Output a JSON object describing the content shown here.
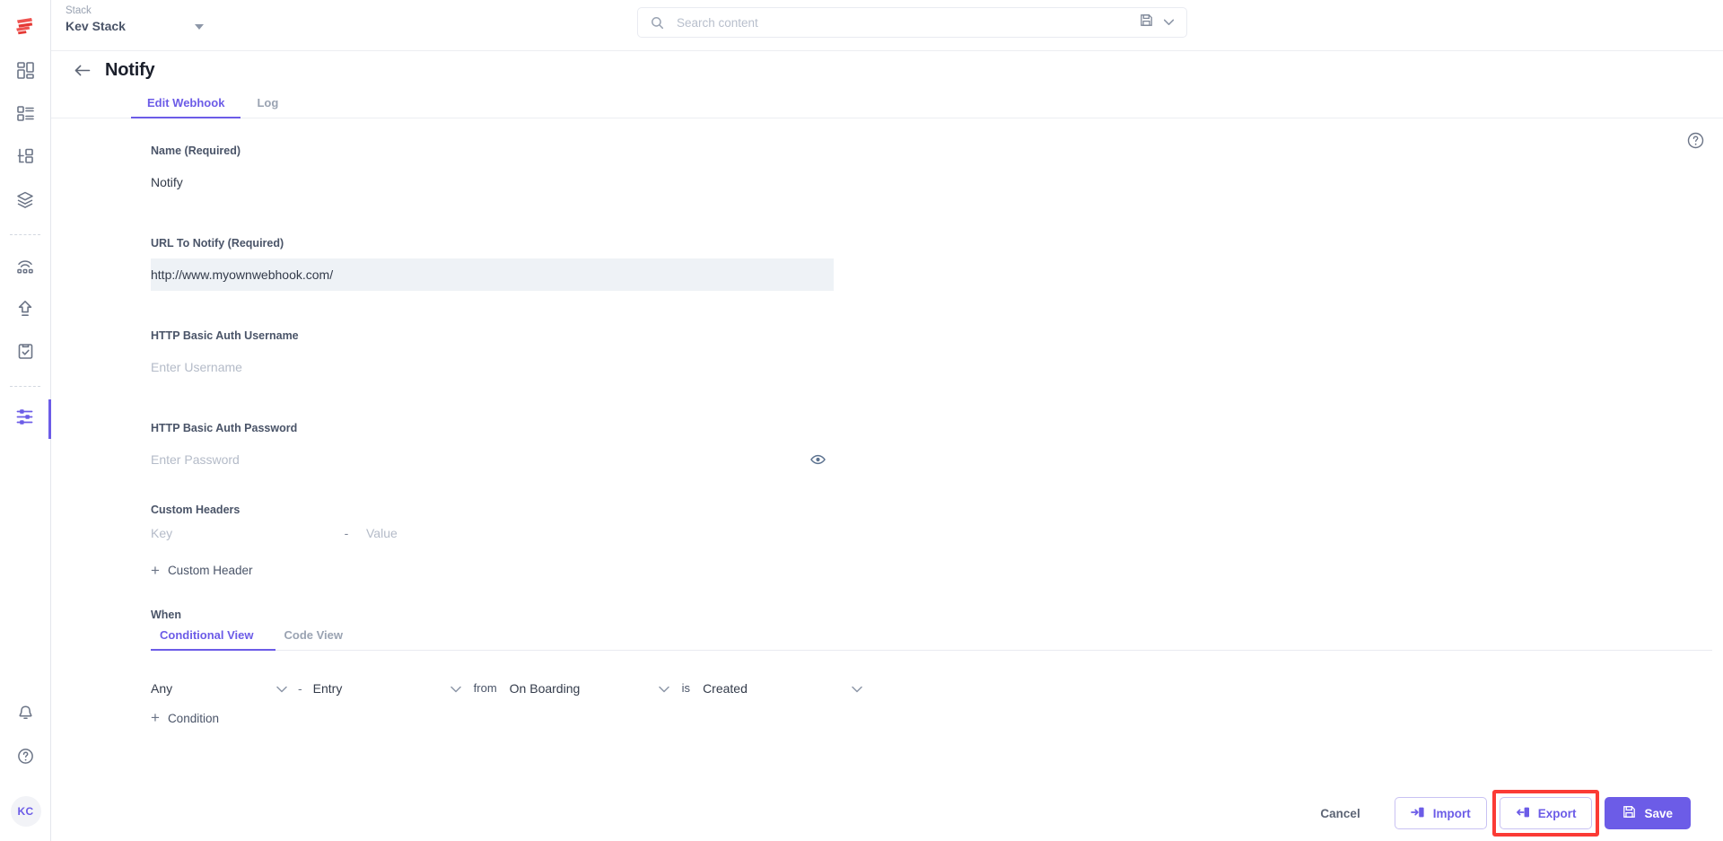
{
  "brand": {
    "accent": "#6c5ce7",
    "highlight": "#fb3b35",
    "logo_icon": "contentstack-logo-icon"
  },
  "topbar": {
    "stack_label": "Stack",
    "stack_name": "Kev Stack",
    "search_placeholder": "Search content",
    "search_value": "",
    "save_search_icon": "floppy-disk-icon",
    "search_dropdown_icon": "chevron-down-icon",
    "search_icon": "search-icon"
  },
  "sidebar": {
    "items": [
      {
        "name": "dashboard",
        "icon": "dashboard-grid-icon",
        "active": false
      },
      {
        "name": "entries",
        "icon": "list-entries-icon",
        "active": false
      },
      {
        "name": "content-models",
        "icon": "content-type-icon",
        "active": false
      },
      {
        "name": "assets",
        "icon": "layers-stack-icon",
        "active": false
      },
      {
        "name": "publish-queue",
        "icon": "broadcast-icon",
        "active": false
      },
      {
        "name": "releases",
        "icon": "upload-arrow-icon",
        "active": false
      },
      {
        "name": "workflow",
        "icon": "clipboard-check-icon",
        "active": false
      },
      {
        "name": "settings",
        "icon": "sliders-settings-icon",
        "active": true
      }
    ],
    "bottom": [
      {
        "name": "notifications",
        "icon": "bell-icon"
      },
      {
        "name": "help",
        "icon": "question-circle-icon"
      }
    ],
    "avatar_initials": "KC"
  },
  "page": {
    "back_icon": "arrow-left-icon",
    "title": "Notify",
    "help_icon": "question-circle-icon",
    "tabs": [
      {
        "label": "Edit Webhook",
        "active": true
      },
      {
        "label": "Log",
        "active": false
      }
    ]
  },
  "form": {
    "name": {
      "label": "Name",
      "required_suffix": "(Required)",
      "value": "Notify"
    },
    "url": {
      "label": "URL To Notify",
      "required_suffix": "(Required)",
      "value": "http://www.myownwebhook.com/"
    },
    "username": {
      "label": "HTTP Basic Auth Username",
      "placeholder": "Enter Username",
      "value": ""
    },
    "password": {
      "label": "HTTP Basic Auth Password",
      "placeholder": "Enter Password",
      "value": "",
      "toggle_icon": "eye-icon"
    },
    "custom_headers": {
      "label": "Custom Headers",
      "key_placeholder": "Key",
      "separator": "-",
      "value_placeholder": "Value",
      "add_label": "Custom Header",
      "add_icon": "plus-icon"
    }
  },
  "when": {
    "label": "When",
    "tabs": [
      {
        "label": "Conditional View",
        "active": true
      },
      {
        "label": "Code View",
        "active": false
      }
    ],
    "condition": {
      "scope": "Any",
      "dash": "-",
      "object": "Entry",
      "from_word": "from",
      "source": "On Boarding",
      "is_word": "is",
      "event": "Created",
      "chevron_icon": "chevron-down-icon"
    },
    "add_condition_label": "Condition",
    "add_condition_icon": "plus-icon"
  },
  "footer": {
    "cancel_label": "Cancel",
    "import_label": "Import",
    "import_icon": "import-arrow-icon",
    "export_label": "Export",
    "export_icon": "export-arrow-icon",
    "export_highlighted": true,
    "save_label": "Save",
    "save_icon": "floppy-disk-icon"
  }
}
